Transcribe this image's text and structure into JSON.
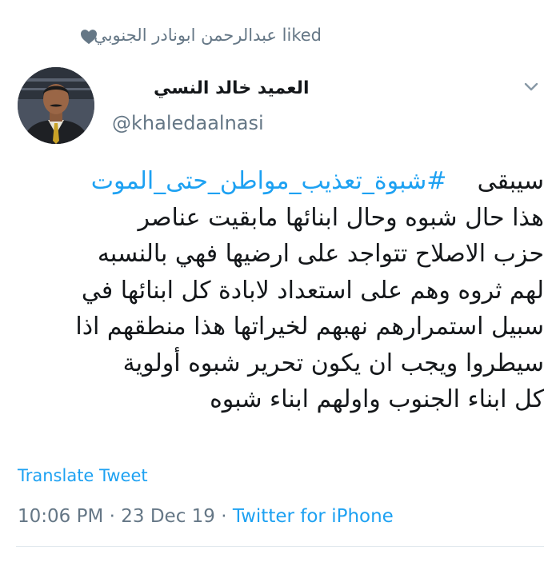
{
  "liked": {
    "user": "عبدالرحمن ابونادر الجنوبي",
    "suffix": "liked",
    "icon": "heart-icon",
    "icon_color": "#657786"
  },
  "author": {
    "display_name": "العميد خالد النسي",
    "handle": "@khaledaalnasi"
  },
  "tweet": {
    "hashtag": "#شبوة_تعذيب_مواطن_حتى_الموت",
    "lines": [
      "سيبقى",
      "هذا حال شبوه وحال ابنائها مابقيت عناصر",
      "حزب الاصلاح تتواجد على ارضيها فهي بالنسبه",
      "لهم ثروه وهم على استعداد لابادة كل ابنائها في",
      "سبيل استمرارهم نهبهم لخيراتها هذا منطقهم اذا",
      "سيطروا ويجب ان يكون تحرير شبوه أولوية",
      "كل ابناء الجنوب واولهم ابناء شبوه"
    ]
  },
  "translate_label": "Translate Tweet",
  "meta": {
    "time": "10:06 PM",
    "separator": " · ",
    "date": "23 Dec 19",
    "source": "Twitter for iPhone"
  },
  "colors": {
    "link": "#1da1f2",
    "secondary": "#657786",
    "text": "#14171a"
  }
}
